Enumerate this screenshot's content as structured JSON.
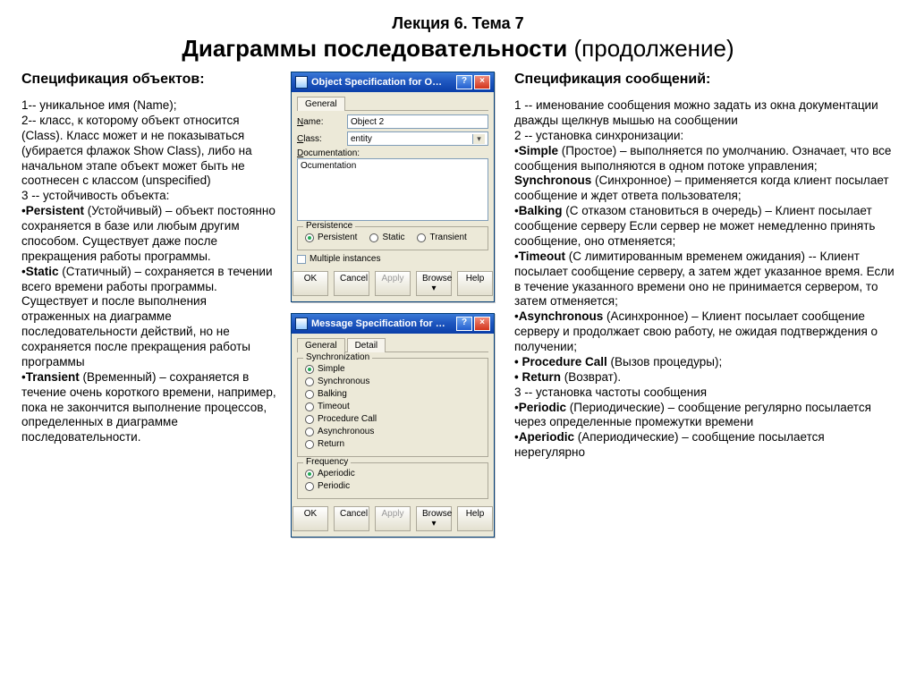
{
  "header": {
    "subtitle": "Лекция 6. Тема 7",
    "title_bold": "Диаграммы последовательности",
    "title_rest": " (продолжение)"
  },
  "left": {
    "heading": "Спецификация объектов:",
    "l1": "1-- уникальное имя (Name);",
    "l2": "2-- класс, к которому объект относится (Class). Класс может и не показываться (убирается флажок Show Class), либо на начальном этапе объект может быть не соотнесен с классом (unspecified)",
    "l3": "3 -- устойчивость объекта:",
    "p1a": "Persistent",
    "p1b": " (Устойчивый) – объект постоянно сохраняется в базе или любым другим способом. Существует даже после прекращения работы программы.",
    "p2a": "Static",
    "p2b": " (Статичный) – сохраняется в течении всего времени работы программы. Существует и после выполнения отраженных на диаграмме последовательности действий, но не сохраняется после прекращения работы программы",
    "p3a": "Transient",
    "p3b": " (Временный) – сохраняется в течение очень короткого времени, например, пока не закончится выполнение процессов, определенных в диаграмме последовательности."
  },
  "right": {
    "heading": "Спецификация сообщений:",
    "m1": "1 -- именование сообщения можно задать из окна документации дважды щелкнув мышью на сообщении",
    "m2": "2 -- установка синхронизации:",
    "s1a": "Simple",
    "s1b": " (Простое) – выполняется по умолчанию. Означает, что все сообщения выполняются в одном потоке управления;",
    "s2a": "Synchronous",
    "s2b": " (Синхронное) – применяется когда клиент посылает сообщение и ждет ответа пользователя;",
    "s3a": "Balking",
    "s3b": " (С отказом становиться в очередь) – Клиент посылает сообщение серверу Если сервер не может немедленно принять сообщение, оно отменяется;",
    "s4a": "Timeout",
    "s4b": " (С лимитированным временем ожидания) -- Клиент посылает сообщение серверу, а затем ждет указанное время. Если в течение указанного времени оно не принимается сервером, то затем отменяется;",
    "s5a": "Asynchronous",
    "s5b": " (Асинхронное) – Клиент посылает сообщение серверу и продолжает свою работу, не ожидая подтверждения о получении;",
    "s6a": "• Procedure Call",
    "s6b": " (Вызов процедуры);",
    "s7a": "• Return",
    "s7b": " (Возврат).",
    "m3": "3 -- установка частоты сообщения",
    "f1a": "Periodic",
    "f1b": " (Периодические) – сообщение регулярно посылается через определенные промежутки времени",
    "f2a": "Aperiodic",
    "f2b": " (Апериодические) – сообщение посылается нерегулярно"
  },
  "dlg1": {
    "title": "Object Specification for O…",
    "tab": "General",
    "name_lbl": "Name:",
    "name_val": "Object 2",
    "class_lbl": "Class:",
    "class_val": "entity",
    "doc_lbl": "Documentation:",
    "doc_val": "Ocumentation",
    "group": "Persistence",
    "r1": "Persistent",
    "r2": "Static",
    "r3": "Transient",
    "chk": "Multiple instances",
    "ok": "OK",
    "cancel": "Cancel",
    "apply": "Apply",
    "browse": "Browse ▾",
    "help": "Help"
  },
  "dlg2": {
    "title": "Message Specification for …",
    "tab1": "General",
    "tab2": "Detail",
    "group1": "Synchronization",
    "r1": "Simple",
    "r2": "Synchronous",
    "r3": "Balking",
    "r4": "Timeout",
    "r5": "Procedure Call",
    "r6": "Asynchronous",
    "r7": "Return",
    "group2": "Frequency",
    "f1": "Aperiodic",
    "f2": "Periodic",
    "ok": "OK",
    "cancel": "Cancel",
    "apply": "Apply",
    "browse": "Browse ▾",
    "help": "Help"
  }
}
